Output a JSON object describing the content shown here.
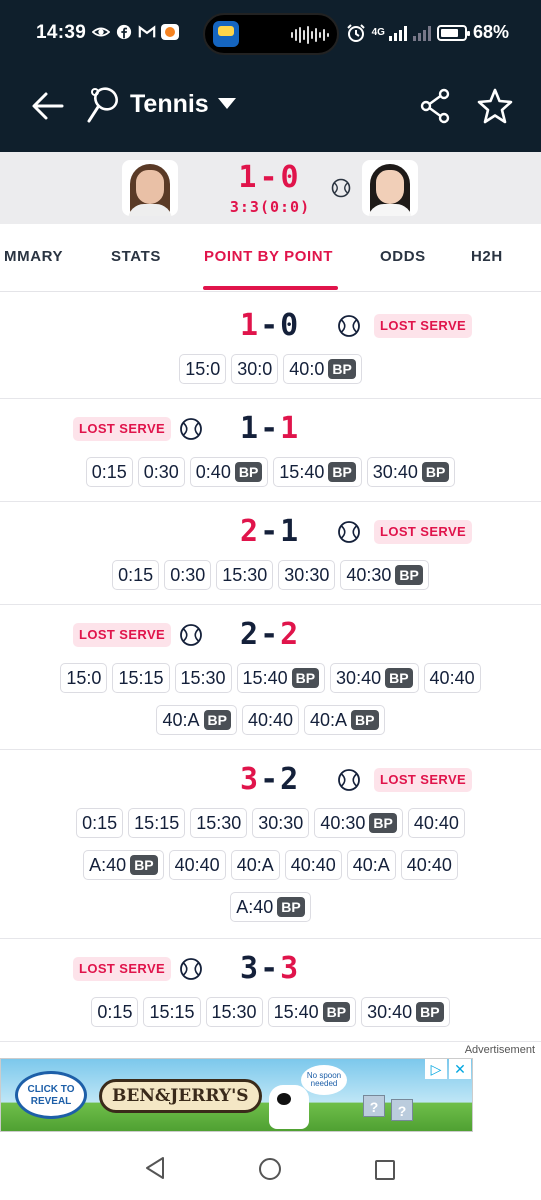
{
  "status_bar": {
    "time": "14:39",
    "network": "4G",
    "battery": "68%",
    "icons": [
      "eye-icon",
      "facebook-icon",
      "gmail-icon",
      "app-icon",
      "alarm-icon",
      "signal-icon",
      "battery-icon"
    ]
  },
  "header": {
    "title": "Tennis",
    "icons": [
      "back-arrow-icon",
      "tennis-racket-icon",
      "dropdown-caret-icon",
      "share-icon",
      "star-icon"
    ]
  },
  "match": {
    "sets_score": "1-0",
    "game_score": "3:3(0:0)",
    "serving_icon": "tennis-ball-icon"
  },
  "tabs": [
    "MMARY",
    "STATS",
    "POINT BY POINT",
    "ODDS",
    "H2H"
  ],
  "active_tab": "POINT BY POINT",
  "lost_serve_label": "LOST SERVE",
  "bp_label": "BP",
  "games": [
    {
      "score_left": "1",
      "score_right": "0",
      "red": "left",
      "server": "right",
      "lost_serve": "right",
      "points": [
        {
          "s": "15:0"
        },
        {
          "s": "30:0"
        },
        {
          "s": "40:0",
          "bp": true
        }
      ]
    },
    {
      "score_left": "1",
      "score_right": "1",
      "red": "right",
      "server": "left",
      "lost_serve": "left",
      "points": [
        {
          "s": "0:15"
        },
        {
          "s": "0:30"
        },
        {
          "s": "0:40",
          "bp": true
        },
        {
          "s": "15:40",
          "bp": true
        },
        {
          "s": "30:40",
          "bp": true
        }
      ]
    },
    {
      "score_left": "2",
      "score_right": "1",
      "red": "left",
      "server": "right",
      "lost_serve": "right",
      "points": [
        {
          "s": "0:15"
        },
        {
          "s": "0:30"
        },
        {
          "s": "15:30"
        },
        {
          "s": "30:30"
        },
        {
          "s": "40:30",
          "bp": true
        }
      ]
    },
    {
      "score_left": "2",
      "score_right": "2",
      "red": "right",
      "server": "left",
      "lost_serve": "left",
      "points": [
        {
          "s": "15:0"
        },
        {
          "s": "15:15"
        },
        {
          "s": "15:30"
        },
        {
          "s": "15:40",
          "bp": true
        },
        {
          "s": "30:40",
          "bp": true
        },
        {
          "s": "40:40"
        },
        {
          "s": "40:A",
          "bp": true
        },
        {
          "s": "40:40"
        },
        {
          "s": "40:A",
          "bp": true
        }
      ]
    },
    {
      "score_left": "3",
      "score_right": "2",
      "red": "left",
      "server": "right",
      "lost_serve": "right",
      "points": [
        {
          "s": "0:15"
        },
        {
          "s": "15:15"
        },
        {
          "s": "15:30"
        },
        {
          "s": "30:30"
        },
        {
          "s": "40:30",
          "bp": true
        },
        {
          "s": "40:40"
        },
        {
          "s": "A:40",
          "bp": true
        },
        {
          "s": "40:40"
        },
        {
          "s": "40:A"
        },
        {
          "s": "40:40"
        },
        {
          "s": "40:A"
        },
        {
          "s": "40:40"
        },
        {
          "s": "A:40",
          "bp": true
        }
      ]
    },
    {
      "score_left": "3",
      "score_right": "3",
      "red": "right",
      "server": "left",
      "lost_serve": "left",
      "points": [
        {
          "s": "0:15"
        },
        {
          "s": "15:15"
        },
        {
          "s": "15:30"
        },
        {
          "s": "15:40",
          "bp": true
        },
        {
          "s": "30:40",
          "bp": true
        }
      ]
    }
  ],
  "ad": {
    "label": "Advertisement",
    "badge_text": "CLICK TO REVEAL",
    "brand": "BEN&JERRY'S",
    "bubble_text": "No spoon needed"
  },
  "nav_icons": [
    "nav-back-icon",
    "nav-home-icon",
    "nav-recents-icon"
  ]
}
